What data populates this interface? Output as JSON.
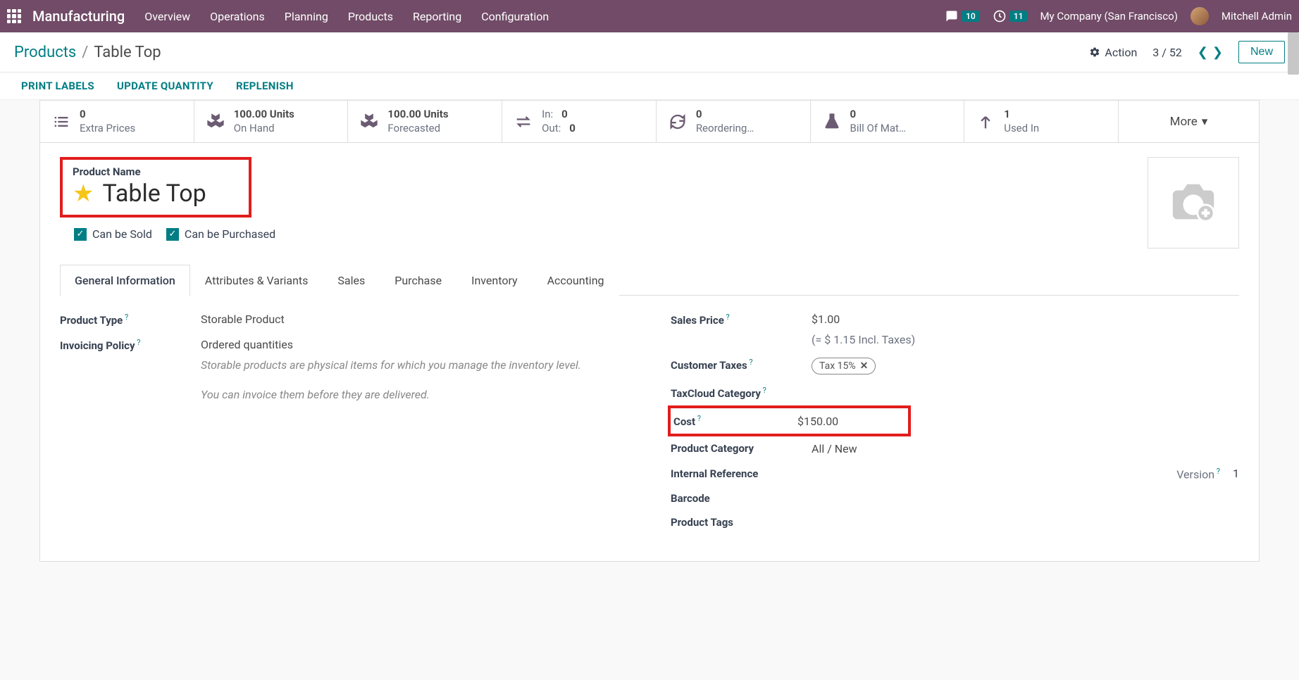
{
  "topbar": {
    "brand": "Manufacturing",
    "nav": [
      "Overview",
      "Operations",
      "Planning",
      "Products",
      "Reporting",
      "Configuration"
    ],
    "messages_badge": "10",
    "activities_badge": "11",
    "company": "My Company (San Francisco)",
    "user": "Mitchell Admin"
  },
  "breadcrumb": {
    "parent": "Products",
    "current": "Table Top"
  },
  "controls": {
    "action": "Action",
    "pager": "3 / 52",
    "new": "New"
  },
  "actions": [
    "PRINT LABELS",
    "UPDATE QUANTITY",
    "REPLENISH"
  ],
  "stats": {
    "extra_prices": {
      "num": "0",
      "label": "Extra Prices"
    },
    "on_hand": {
      "num": "100.00 Units",
      "label": "On Hand"
    },
    "forecasted": {
      "num": "100.00 Units",
      "label": "Forecasted"
    },
    "in": "0",
    "out": "0",
    "in_label": "In:",
    "out_label": "Out:",
    "reordering": {
      "num": "0",
      "label": "Reordering…"
    },
    "bom": {
      "num": "0",
      "label": "Bill Of Mat…"
    },
    "used_in": {
      "num": "1",
      "label": "Used In"
    },
    "more": "More"
  },
  "product": {
    "name_label": "Product Name",
    "name": "Table Top",
    "can_be_sold": "Can be Sold",
    "can_be_purchased": "Can be Purchased"
  },
  "tabs": [
    "General Information",
    "Attributes & Variants",
    "Sales",
    "Purchase",
    "Inventory",
    "Accounting"
  ],
  "left_fields": {
    "product_type_label": "Product Type",
    "product_type_value": "Storable Product",
    "invoicing_policy_label": "Invoicing Policy",
    "invoicing_policy_value": "Ordered quantities",
    "desc1": "Storable products are physical items for which you manage the inventory level.",
    "desc2": "You can invoice them before they are delivered."
  },
  "right_fields": {
    "sales_price_label": "Sales Price",
    "sales_price_value": "$1.00",
    "sales_price_incl": "(= $ 1.15 Incl. Taxes)",
    "customer_taxes_label": "Customer Taxes",
    "customer_taxes_value": "Tax 15%",
    "taxcloud_label": "TaxCloud Category",
    "cost_label": "Cost",
    "cost_value": "$150.00",
    "product_category_label": "Product Category",
    "product_category_value": "All / New",
    "internal_ref_label": "Internal Reference",
    "version_label": "Version",
    "version_value": "1",
    "barcode_label": "Barcode",
    "product_tags_label": "Product Tags"
  }
}
